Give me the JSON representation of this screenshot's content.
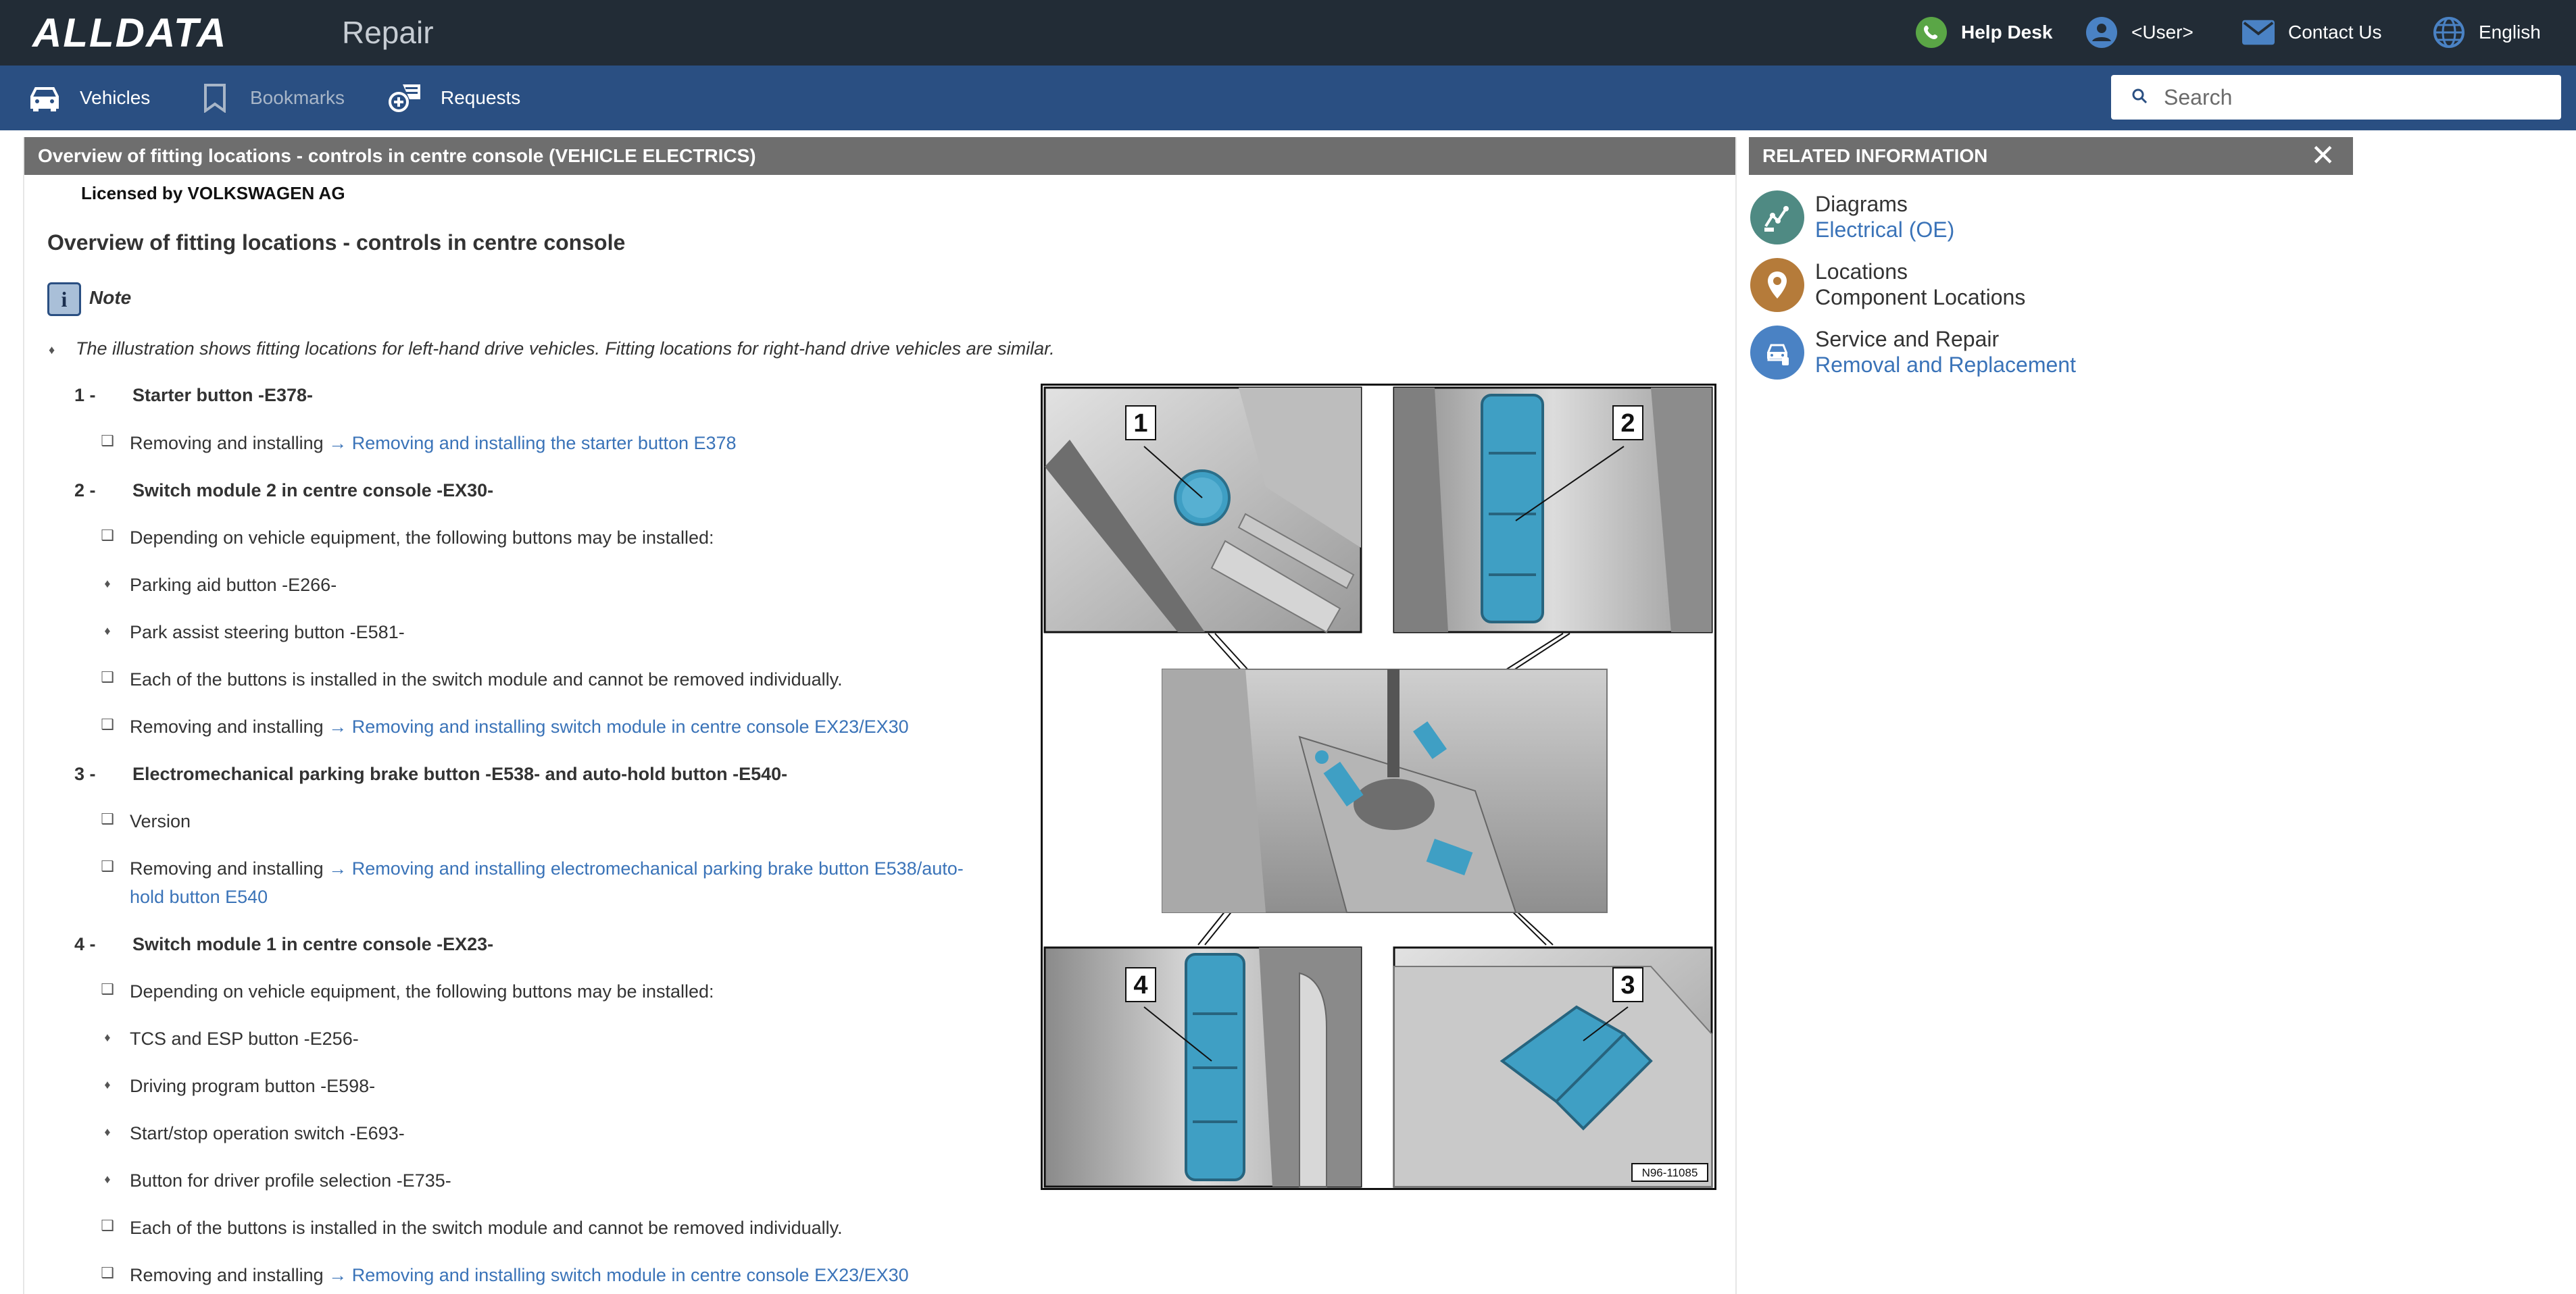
{
  "header": {
    "logo": "ALLDATA",
    "product": "Repair",
    "help_desk": "Help Desk",
    "user": "<User>",
    "contact": "Contact Us",
    "language": "English"
  },
  "nav": {
    "vehicles": "Vehicles",
    "bookmarks": "Bookmarks",
    "requests": "Requests",
    "search_placeholder": "Search"
  },
  "document": {
    "titlebar": "Overview of fitting locations - controls in centre console (VEHICLE ELECTRICS)",
    "licensed": "Licensed by VOLKSWAGEN AG",
    "title": "Overview of fitting locations - controls in centre console",
    "note_label": "Note",
    "note_text": "The illustration shows fitting locations for left-hand drive vehicles. Fitting locations for right-hand drive vehicles are similar.",
    "removing_prefix": "Removing and installing",
    "arrow": "→",
    "items": [
      {
        "num": "1 -",
        "title": "Starter button -E378-",
        "link": "Removing and installing the starter button E378"
      },
      {
        "num": "2 -",
        "title": "Switch module 2 in centre console -EX30-",
        "depending": "Depending on vehicle equipment, the following buttons may be installed:",
        "buttons": [
          "Parking aid button -E266-",
          "Park assist steering button -E581-"
        ],
        "each": "Each of the buttons is installed in the switch module and cannot be removed individually.",
        "link": "Removing and installing switch module in centre console EX23/EX30"
      },
      {
        "num": "3 -",
        "title": "Electromechanical parking brake button -E538- and auto-hold button -E540-",
        "version": "Version",
        "link_line1": "Removing and installing electromechanical parking brake button E538/auto-",
        "link_line2": "hold button E540"
      },
      {
        "num": "4 -",
        "title": "Switch module 1 in centre console -EX23-",
        "depending": "Depending on vehicle equipment, the following buttons may be installed:",
        "buttons": [
          "TCS and ESP button -E256-",
          "Driving program button -E598-",
          "Start/stop operation switch -E693-",
          "Button for driver profile selection -E735-"
        ],
        "each": "Each of the buttons is installed in the switch module and cannot be removed individually.",
        "link": "Removing and installing switch module in centre console EX23/EX30"
      }
    ],
    "figure": {
      "callouts": [
        "1",
        "2",
        "3",
        "4"
      ],
      "code": "N96-11085"
    }
  },
  "related": {
    "title": "RELATED INFORMATION",
    "items": [
      {
        "title": "Diagrams",
        "sub": "Electrical (OE)",
        "icon": "diagram-icon",
        "color": "#4f8a83",
        "sub_is_link": true
      },
      {
        "title": "Locations",
        "sub": "Component Locations",
        "icon": "location-pin-icon",
        "color": "#b57b3a",
        "sub_is_link": false
      },
      {
        "title": "Service and Repair",
        "sub": "Removal and Replacement",
        "icon": "car-service-icon",
        "color": "#4a82c4",
        "sub_is_link": true
      }
    ]
  },
  "colors": {
    "topbar": "#222c36",
    "navbar": "#2a4f82",
    "titlebar": "#6e6e6e",
    "link": "#3a73b8",
    "highlight": "#3f9fc4"
  }
}
